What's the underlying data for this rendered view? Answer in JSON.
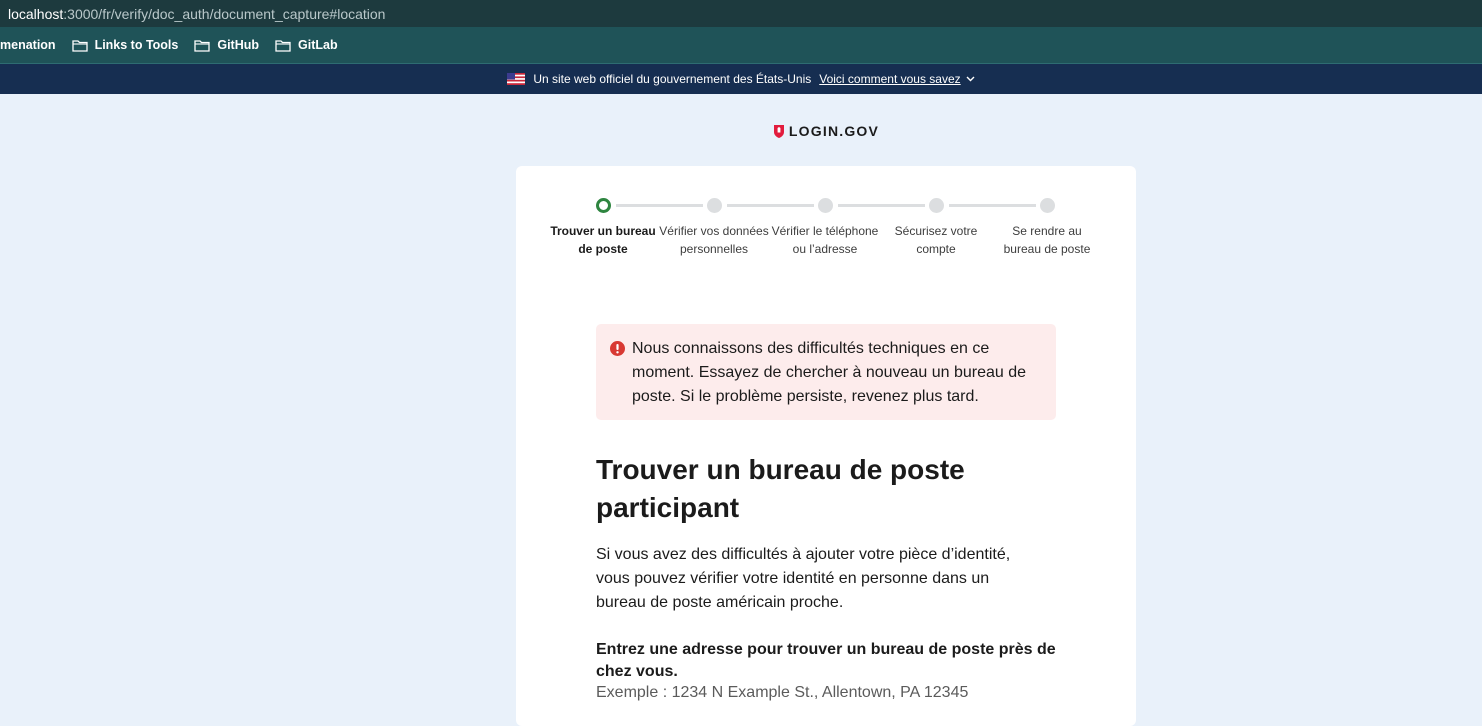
{
  "browser": {
    "url_host": "localhost",
    "url_path": ":3000/fr/verify/doc_auth/document_capture#location",
    "bookmarks": [
      {
        "label": "menation"
      },
      {
        "label": "Links to Tools"
      },
      {
        "label": "GitHub"
      },
      {
        "label": "GitLab"
      }
    ]
  },
  "gov_banner": {
    "text": "Un site web officiel du gouvernement des États-Unis",
    "link": "Voici comment vous savez"
  },
  "logo": {
    "text": "LOGIN.GOV"
  },
  "steps": [
    {
      "label": "Trouver un bureau de poste",
      "current": true
    },
    {
      "label": "Vérifier vos données personnelles",
      "current": false
    },
    {
      "label": "Vérifier le téléphone ou l’adresse",
      "current": false
    },
    {
      "label": "Sécurisez votre compte",
      "current": false
    },
    {
      "label": "Se rendre au bureau de poste",
      "current": false
    }
  ],
  "alert": {
    "text": "Nous connaissons des difficultés techniques en ce moment. Essayez de chercher à nouveau un bureau de poste. Si le problème persiste, revenez plus tard."
  },
  "main": {
    "heading": "Trouver un bureau de poste participant",
    "intro": "Si vous avez des difficultés à ajouter votre pièce d’identité, vous pouvez vérifier votre identité en personne dans un bureau de poste américain proche.",
    "address_label": "Entrez une adresse pour trouver un bureau de poste près de chez vous.",
    "address_hint": "Exemple : 1234 N Example St., Allentown, PA 12345"
  },
  "colors": {
    "current_step": "#2e8540",
    "banner_bg": "#162e51",
    "alert_bg": "#fdecec",
    "error_icon": "#d83933",
    "logo_shield": "#e21c3d"
  }
}
